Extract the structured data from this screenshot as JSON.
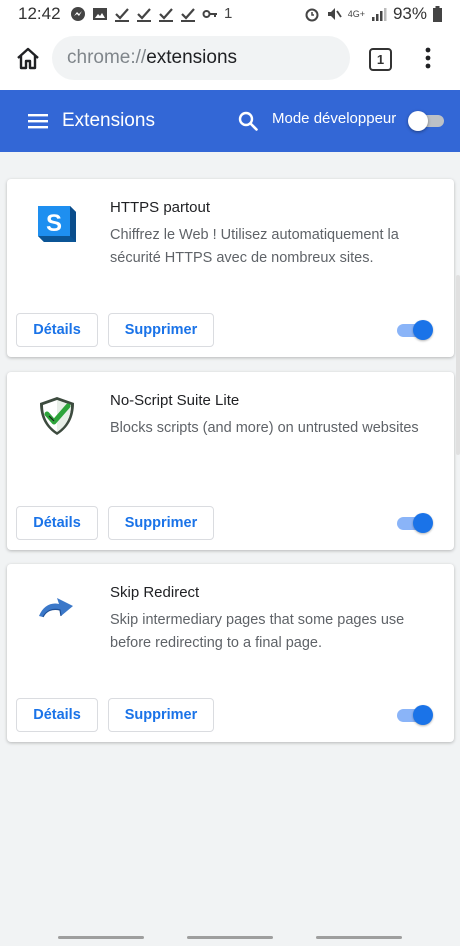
{
  "status_bar": {
    "time": "12:42",
    "sim_slot": "1",
    "network": "4G+",
    "battery": "93%"
  },
  "browser": {
    "url_scheme": "chrome://",
    "url_host": "extensions",
    "tab_count": "1"
  },
  "header": {
    "title": "Extensions",
    "dev_mode_label": "Mode développeur",
    "dev_mode_enabled": false,
    "accent_color": "#3367d6"
  },
  "extensions": [
    {
      "name": "HTTPS partout",
      "description": "Chiffrez le Web ! Utilisez automatiquement la sécurité HTTPS avec de nombreux sites.",
      "icon": "https-everywhere-icon",
      "details_label": "Détails",
      "remove_label": "Supprimer",
      "enabled": true
    },
    {
      "name": "No-Script Suite Lite",
      "description": "Blocks scripts (and more) on untrusted websites",
      "icon": "shield-check-icon",
      "details_label": "Détails",
      "remove_label": "Supprimer",
      "enabled": true
    },
    {
      "name": "Skip Redirect",
      "description": "Skip intermediary pages that some pages use before redirecting to a final page.",
      "icon": "redirect-arrow-icon",
      "details_label": "Détails",
      "remove_label": "Supprimer",
      "enabled": true
    }
  ]
}
